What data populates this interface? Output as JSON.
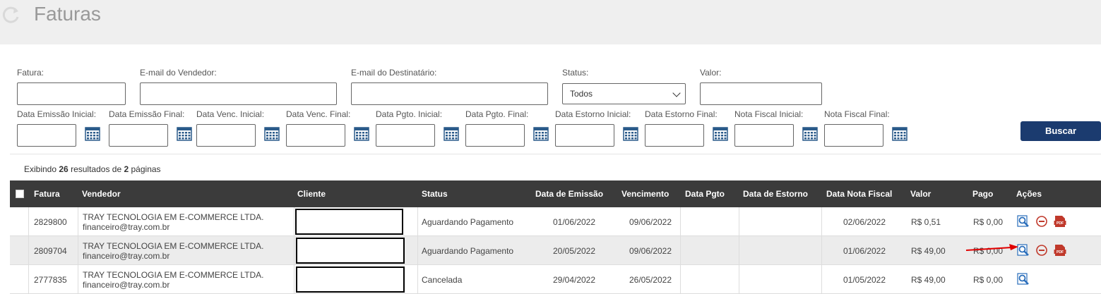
{
  "header": {
    "title": "Faturas",
    "icon": "refresh-icon"
  },
  "filters": {
    "fatura_label": "Fatura:",
    "email_vendedor_label": "E-mail do Vendedor:",
    "email_destinatario_label": "E-mail do Destinatário:",
    "status_label": "Status:",
    "status_value": "Todos",
    "valor_label": "Valor:",
    "dates": [
      {
        "label": "Data Emissão Inicial:"
      },
      {
        "label": "Data Emissão Final:"
      },
      {
        "label": "Data Venc. Inicial:"
      },
      {
        "label": "Data Venc. Final:"
      },
      {
        "label": "Data Pgto. Inicial:"
      },
      {
        "label": "Data Pgto. Final:"
      },
      {
        "label": "Data Estorno Inicial:"
      },
      {
        "label": "Data Estorno Final:"
      },
      {
        "label": "Nota Fiscal Inicial:"
      },
      {
        "label": "Nota Fiscal Final:"
      }
    ],
    "search_label": "Buscar"
  },
  "summary": {
    "prefix": "Exibindo",
    "results": "26",
    "middle": "resultados de",
    "pages": "2",
    "suffix": "páginas"
  },
  "table": {
    "columns": [
      "Fatura",
      "Vendedor",
      "Cliente",
      "Status",
      "Data de Emissão",
      "Vencimento",
      "Data Pgto",
      "Data de Estorno",
      "Data Nota Fiscal",
      "Valor",
      "Pago",
      "Ações"
    ],
    "rows": [
      {
        "fatura": "2829800",
        "vendedor": "TRAY TECNOLOGIA EM E-COMMERCE LTDA.",
        "email": "financeiro@tray.com.br",
        "status": "Aguardando Pagamento",
        "emissao": "01/06/2022",
        "vencimento": "09/06/2022",
        "pgto": "",
        "estorno": "",
        "nota": "02/06/2022",
        "valor": "R$ 0,51",
        "pago": "R$ 0,00",
        "actions": [
          "view-invoice-icon",
          "cancel-icon",
          "pdf-icon"
        ]
      },
      {
        "fatura": "2809704",
        "vendedor": "TRAY TECNOLOGIA EM E-COMMERCE LTDA.",
        "email": "financeiro@tray.com.br",
        "status": "Aguardando Pagamento",
        "emissao": "20/05/2022",
        "vencimento": "09/06/2022",
        "pgto": "",
        "estorno": "",
        "nota": "01/06/2022",
        "valor": "R$ 49,00",
        "pago": "R$ 0,00",
        "actions": [
          "view-invoice-icon",
          "cancel-icon",
          "pdf-icon"
        ]
      },
      {
        "fatura": "2777835",
        "vendedor": "TRAY TECNOLOGIA EM E-COMMERCE LTDA.",
        "email": "financeiro@tray.com.br",
        "status": "Cancelada",
        "emissao": "29/04/2022",
        "vencimento": "26/05/2022",
        "pgto": "",
        "estorno": "",
        "nota": "01/05/2022",
        "valor": "R$ 49,00",
        "pago": "R$ 0,00",
        "actions": [
          "view-invoice-icon"
        ]
      }
    ]
  },
  "colors": {
    "header_bg": "#efefef",
    "button": "#1b3b6f",
    "table_header": "#3b3b3b",
    "accent_blue": "#2a6ebb",
    "danger": "#c0392b",
    "arrow": "#e00000"
  }
}
